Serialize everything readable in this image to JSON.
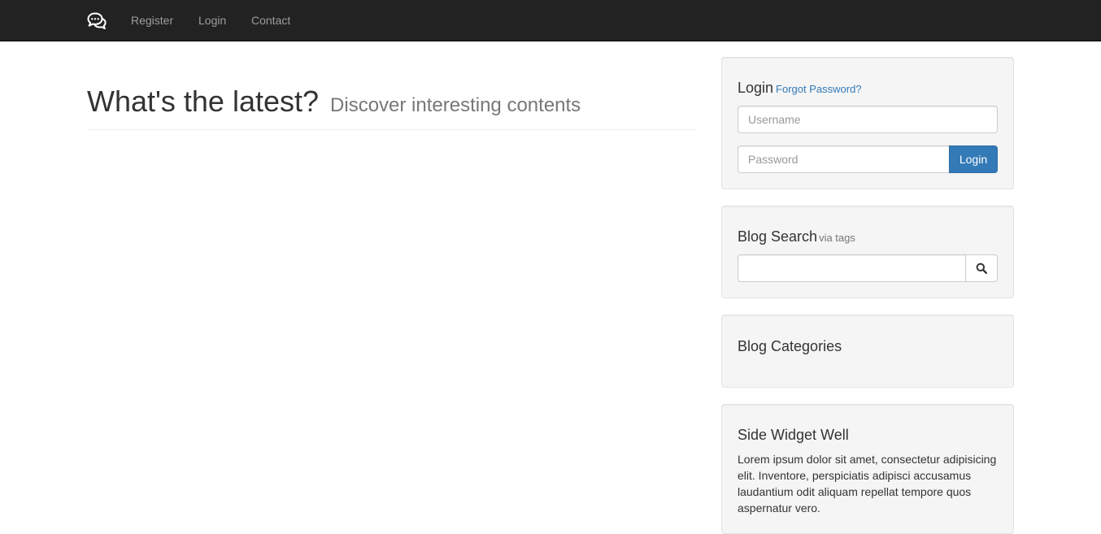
{
  "navbar": {
    "brand_icon": "chat-bubbles-icon",
    "links": [
      "Register",
      "Login",
      "Contact"
    ],
    "colors": {
      "background": "#222222",
      "link": "#9d9d9d"
    }
  },
  "main": {
    "title": "What's the latest?",
    "subtitle": "Discover interesting contents"
  },
  "login_well": {
    "title": "Login",
    "forgot_link": "Forgot Password?",
    "username_placeholder": "Username",
    "password_placeholder": "Password",
    "button_label": "Login",
    "accent": "#337ab7"
  },
  "search_well": {
    "title": "Blog Search",
    "subtitle": "via tags",
    "search_icon": "search-icon"
  },
  "categories_well": {
    "title": "Blog Categories"
  },
  "side_widget": {
    "title": "Side Widget Well",
    "text": "Lorem ipsum dolor sit amet, consectetur adipisicing elit. Inventore, perspiciatis adipisci accusamus laudantium odit aliquam repellat tempore quos aspernatur vero."
  }
}
